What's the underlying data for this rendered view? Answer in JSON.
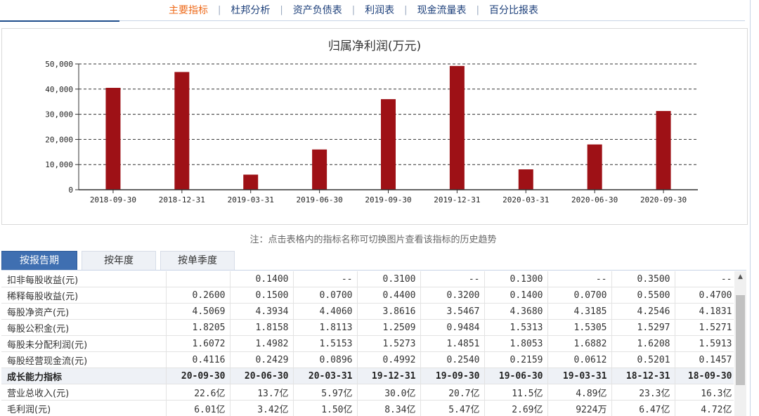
{
  "nav": {
    "items": [
      {
        "label": "主要指标",
        "active": true
      },
      {
        "label": "杜邦分析",
        "active": false
      },
      {
        "label": "资产负债表",
        "active": false
      },
      {
        "label": "利润表",
        "active": false
      },
      {
        "label": "现金流量表",
        "active": false
      },
      {
        "label": "百分比报表",
        "active": false
      }
    ],
    "separator": "|"
  },
  "chart_data": {
    "type": "bar",
    "title": "归属净利润(万元)",
    "categories": [
      "2018-09-30",
      "2018-12-31",
      "2019-03-31",
      "2019-06-30",
      "2019-09-30",
      "2019-12-31",
      "2020-03-31",
      "2020-06-30",
      "2020-09-30"
    ],
    "values": [
      40500,
      46800,
      6000,
      16000,
      36000,
      49200,
      8100,
      18000,
      31300
    ],
    "ylim": [
      0,
      50000
    ],
    "yticks": [
      0,
      10000,
      20000,
      30000,
      40000,
      50000
    ],
    "ytick_labels": [
      "0",
      "10,000",
      "20,000",
      "30,000",
      "40,000",
      "50,000"
    ],
    "grid": true,
    "bar_color": "#9e1116"
  },
  "note": "注：点击表格内的指标名称可切换图片查看该指标的历史趋势",
  "tabs": [
    {
      "label": "按报告期",
      "active": true
    },
    {
      "label": "按年度",
      "active": false
    },
    {
      "label": "按单季度",
      "active": false
    }
  ],
  "table": {
    "rows": [
      {
        "label": "扣非每股收益(元)",
        "values": [
          "",
          "0.1400",
          "--",
          "0.3100",
          "--",
          "0.1300",
          "--",
          "0.3500",
          "--"
        ]
      },
      {
        "label": "稀释每股收益(元)",
        "values": [
          "0.2600",
          "0.1500",
          "0.0700",
          "0.4400",
          "0.3200",
          "0.1400",
          "0.0700",
          "0.5500",
          "0.4700"
        ]
      },
      {
        "label": "每股净资产(元)",
        "values": [
          "4.5069",
          "4.3934",
          "4.4060",
          "3.8616",
          "3.5467",
          "4.3680",
          "4.3185",
          "4.2546",
          "4.1831"
        ]
      },
      {
        "label": "每股公积金(元)",
        "values": [
          "1.8205",
          "1.8158",
          "1.8113",
          "1.2509",
          "0.9484",
          "1.5313",
          "1.5305",
          "1.5297",
          "1.5271"
        ]
      },
      {
        "label": "每股未分配利润(元)",
        "values": [
          "1.6072",
          "1.4982",
          "1.5153",
          "1.5273",
          "1.4851",
          "1.8053",
          "1.6882",
          "1.6208",
          "1.5913"
        ]
      },
      {
        "label": "每股经营现金流(元)",
        "values": [
          "0.4116",
          "0.2429",
          "0.0896",
          "0.4992",
          "0.2540",
          "0.2159",
          "0.0612",
          "0.5201",
          "0.1457"
        ]
      },
      {
        "label": "成长能力指标",
        "header": true,
        "values": [
          "20-09-30",
          "20-06-30",
          "20-03-31",
          "19-12-31",
          "19-09-30",
          "19-06-30",
          "19-03-31",
          "18-12-31",
          "18-09-30"
        ]
      },
      {
        "label": "营业总收入(元)",
        "values": [
          "22.6亿",
          "13.7亿",
          "5.97亿",
          "30.0亿",
          "20.7亿",
          "11.5亿",
          "4.89亿",
          "23.3亿",
          "16.3亿"
        ]
      },
      {
        "label": "毛利润(元)",
        "values": [
          "6.01亿",
          "3.42亿",
          "1.50亿",
          "8.34亿",
          "5.47亿",
          "2.69亿",
          "9224万",
          "6.47亿",
          "4.72亿"
        ]
      }
    ]
  }
}
